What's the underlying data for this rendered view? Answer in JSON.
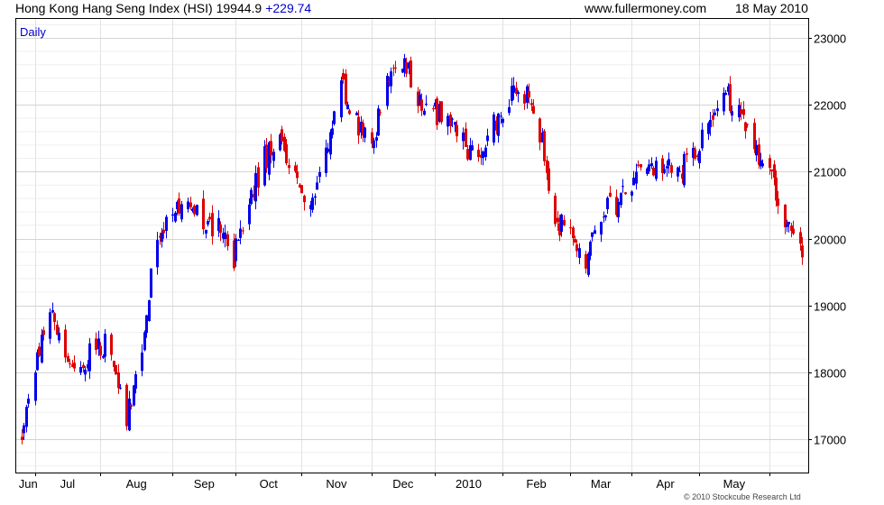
{
  "header": {
    "title": "Hong Kong Hang Seng Index (HSI)",
    "last": "19944.9",
    "change": "+229.74",
    "site": "www.fullermoney.com",
    "date": "18 May 2010"
  },
  "colors": {
    "up": "#0000ee",
    "down": "#dd0000",
    "grid": "#dddddd",
    "frame": "#000000"
  },
  "copyright": "© 2010 Stockcube Research Ltd",
  "chart_data": {
    "type": "candlestick",
    "period_label": "Daily",
    "ylim": [
      16500,
      23300
    ],
    "yticks": [
      17000,
      18000,
      19000,
      20000,
      21000,
      22000,
      23000
    ],
    "month_labels": [
      "Jun",
      "Jul",
      "Aug",
      "Sep",
      "Oct",
      "Nov",
      "Dec",
      "2010",
      "Feb",
      "Mar",
      "Apr",
      "May"
    ],
    "start": "2009-05-26",
    "end": "2010-05-18",
    "anchors": [
      [
        "2009-05-26",
        17100
      ],
      [
        "2009-06-01",
        18100
      ],
      [
        "2009-06-08",
        18900
      ],
      [
        "2009-06-15",
        18200
      ],
      [
        "2009-06-22",
        18100
      ],
      [
        "2009-06-29",
        18400
      ],
      [
        "2009-07-06",
        18400
      ],
      [
        "2009-07-13",
        17300
      ],
      [
        "2009-07-20",
        18400
      ],
      [
        "2009-07-27",
        20100
      ],
      [
        "2009-08-03",
        20400
      ],
      [
        "2009-08-10",
        20700
      ],
      [
        "2009-08-17",
        20200
      ],
      [
        "2009-08-24",
        20200
      ],
      [
        "2009-08-31",
        19700
      ],
      [
        "2009-09-07",
        20500
      ],
      [
        "2009-09-14",
        21200
      ],
      [
        "2009-09-21",
        21500
      ],
      [
        "2009-09-28",
        20900
      ],
      [
        "2009-10-05",
        20500
      ],
      [
        "2009-10-12",
        21300
      ],
      [
        "2009-10-19",
        22300
      ],
      [
        "2009-10-26",
        21700
      ],
      [
        "2009-11-02",
        21300
      ],
      [
        "2009-11-09",
        22400
      ],
      [
        "2009-11-16",
        22700
      ],
      [
        "2009-11-23",
        22100
      ],
      [
        "2009-11-30",
        21900
      ],
      [
        "2009-12-07",
        21800
      ],
      [
        "2009-12-14",
        21400
      ],
      [
        "2009-12-21",
        21200
      ],
      [
        "2009-12-28",
        21700
      ],
      [
        "2010-01-04",
        22100
      ],
      [
        "2010-01-11",
        22200
      ],
      [
        "2010-01-18",
        21600
      ],
      [
        "2010-01-25",
        20300
      ],
      [
        "2010-02-01",
        20000
      ],
      [
        "2010-02-08",
        19700
      ],
      [
        "2010-02-15",
        20400
      ],
      [
        "2010-02-22",
        20500
      ],
      [
        "2010-03-01",
        20800
      ],
      [
        "2010-03-08",
        21200
      ],
      [
        "2010-03-15",
        21000
      ],
      [
        "2010-03-22",
        21000
      ],
      [
        "2010-03-29",
        21200
      ],
      [
        "2010-04-06",
        21900
      ],
      [
        "2010-04-12",
        22200
      ],
      [
        "2010-04-19",
        21900
      ],
      [
        "2010-04-26",
        21400
      ],
      [
        "2010-05-03",
        21000
      ],
      [
        "2010-05-10",
        20200
      ],
      [
        "2010-05-18",
        19900
      ]
    ]
  }
}
